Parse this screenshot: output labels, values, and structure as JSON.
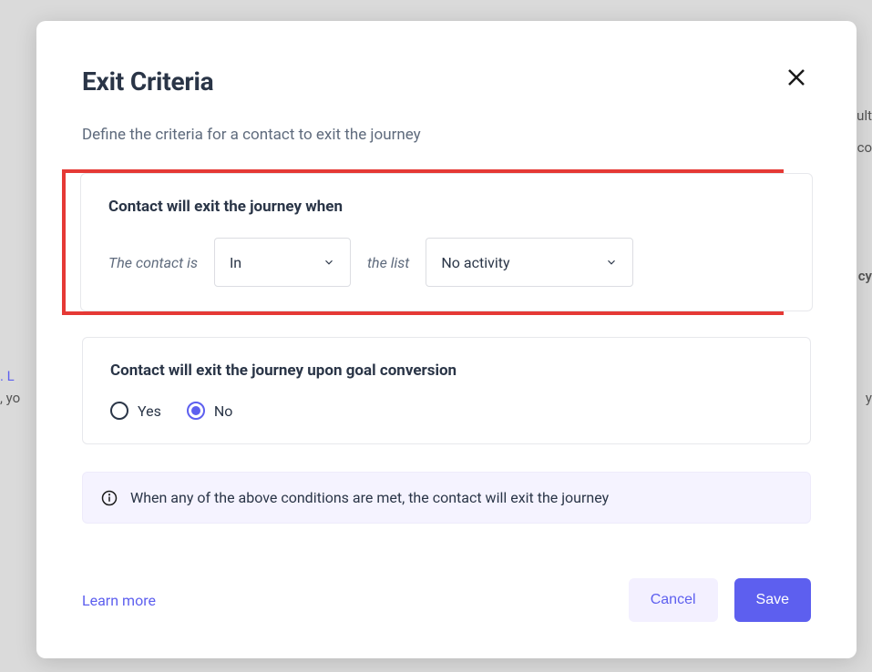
{
  "modal": {
    "title": "Exit Criteria",
    "subtitle": "Define the criteria for a contact to exit the journey",
    "section1": {
      "title": "Contact will exit the journey when",
      "lead_text": "The contact is",
      "dropdown1_value": "In",
      "mid_text": "the list",
      "dropdown2_value": "No activity"
    },
    "section2": {
      "title": "Contact will exit the journey upon goal conversion",
      "option_yes": "Yes",
      "option_no": "No",
      "selected": "No"
    },
    "info_text": "When any of the above conditions are met, the contact will exit the journey",
    "learn_more": "Learn more",
    "cancel": "Cancel",
    "save": "Save"
  }
}
